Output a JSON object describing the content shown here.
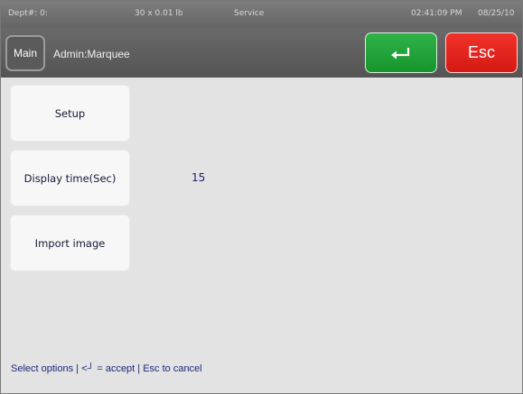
{
  "status_bar": {
    "dept": "Dept#: 0:",
    "weight": "30 x 0.01 lb",
    "mode": "Service",
    "time": "02:41:09 PM",
    "date": "08/25/10"
  },
  "header": {
    "main_label": "Main",
    "title": "Admin:Marquee",
    "accept_icon": "enter-arrow-icon",
    "esc_label": "Esc",
    "accept_color": "#1fa33a",
    "esc_color": "#e0241c"
  },
  "options": [
    {
      "label": "Setup"
    },
    {
      "label": "Display time(Sec)",
      "value": "15"
    },
    {
      "label": "Import image"
    }
  ],
  "footer": {
    "hint": "Select options | <┘ = accept | Esc to cancel"
  }
}
